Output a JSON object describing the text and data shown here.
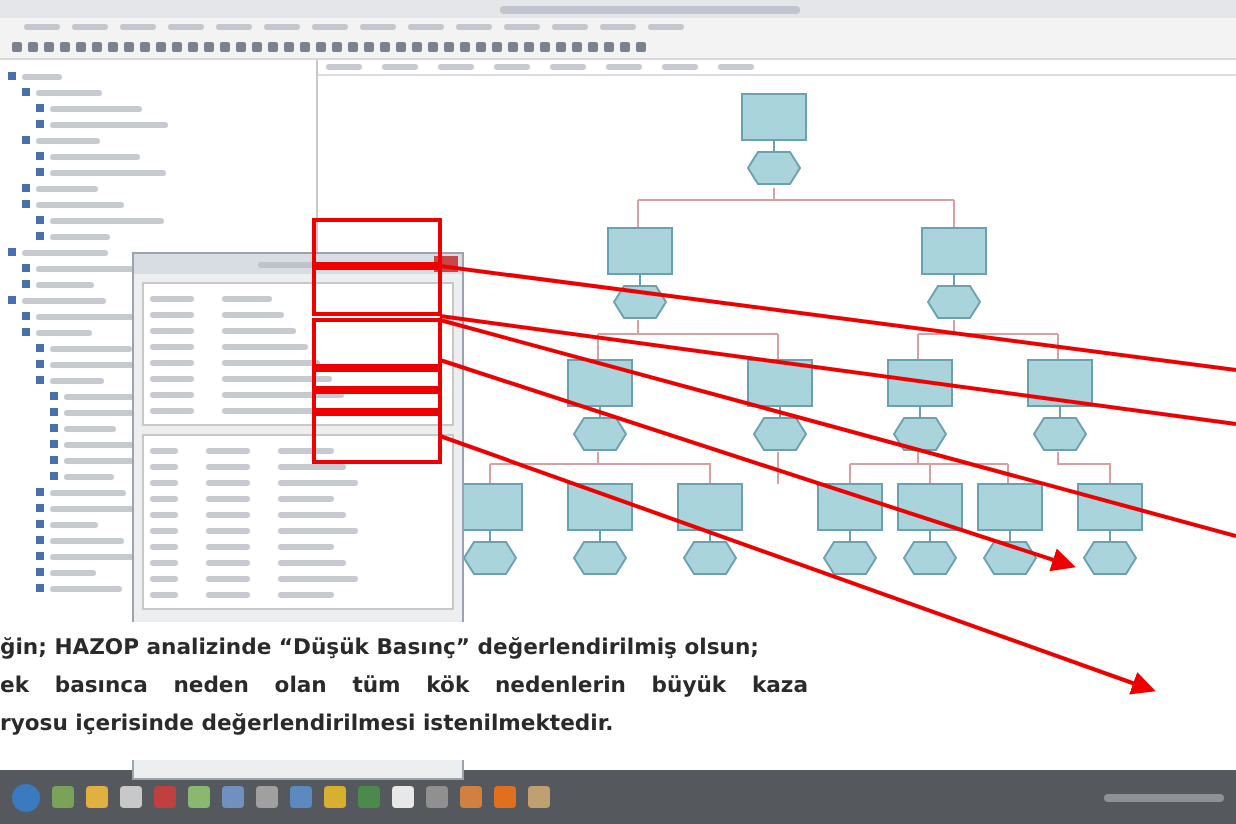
{
  "caption": {
    "lines": [
      {
        "text": "ğin; HAZOP analizinde “Düşük Basınç” değerlendirilmiş olsun;",
        "justify": false
      },
      {
        "text": "ek basınca neden olan tüm kök nedenlerin büyük kaza",
        "justify": true
      },
      {
        "text": "ryosu içerisinde değerlendirilmesi istenilmektedir.",
        "justify": false
      }
    ]
  }
}
